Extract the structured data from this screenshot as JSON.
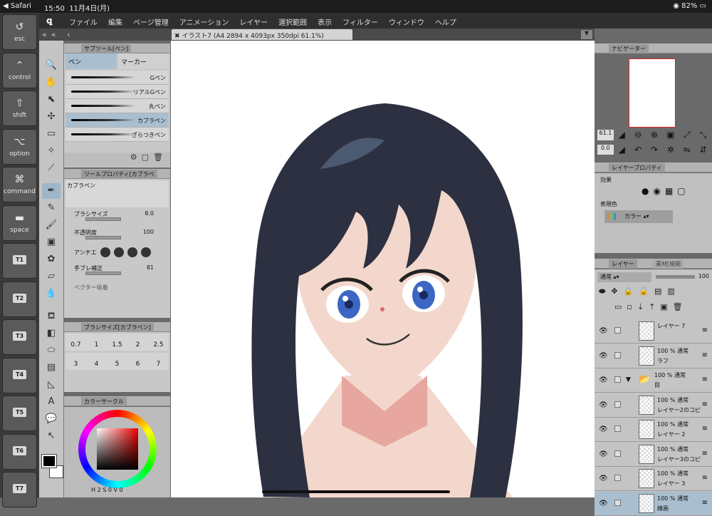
{
  "status": {
    "app": "◀ Safari",
    "time": "15:50",
    "date": "11月4日(月)",
    "battery": "82%"
  },
  "menu": {
    "logo": "ꝗ",
    "items": [
      "ファイル",
      "編集",
      "ページ管理",
      "アニメーション",
      "レイヤー",
      "選択範囲",
      "表示",
      "フィルター",
      "ウィンドウ",
      "ヘルプ"
    ]
  },
  "keys": [
    {
      "icon": "↺",
      "label": "esc"
    },
    {
      "icon": "⌃",
      "label": "control"
    },
    {
      "icon": "⇧",
      "label": "shift"
    },
    {
      "icon": "⌥",
      "label": "option"
    },
    {
      "icon": "⌘",
      "label": "command"
    },
    {
      "icon": "▬",
      "label": "space"
    },
    {
      "tb": "T1"
    },
    {
      "tb": "T2"
    },
    {
      "tb": "T3"
    },
    {
      "tb": "T4"
    },
    {
      "tb": "T5"
    },
    {
      "tb": "T6"
    },
    {
      "tb": "T7"
    }
  ],
  "document": {
    "tab": "イラスト7 (A4 2894 x 4093px 350dpi 61.1%)"
  },
  "subtool": {
    "title": "サブツール[ペン]",
    "tabs": [
      "ペン",
      "マーカー"
    ],
    "items": [
      "Gペン",
      "リアルGペン",
      "丸ペン",
      "カブラペン",
      "ざらつきペン"
    ],
    "selected": 3
  },
  "toolprop": {
    "title": "ツールプロパティ[カブラペ",
    "brush_name": "カブラペン",
    "size_label": "ブラシサイズ",
    "size_value": "8.0",
    "opacity_label": "不透明度",
    "opacity_value": "100",
    "aa_label": "アンチエ",
    "stab_label": "手ブレ補正",
    "stab_value": "81",
    "vector_label": "ベクター吸着"
  },
  "brushsize": {
    "title": "ブラシサイズ[カブラペン]",
    "values": [
      "0.7",
      "1",
      "1.5",
      "2",
      "2.5",
      "3",
      "4",
      "5",
      "6",
      "7"
    ]
  },
  "colorcircle": {
    "title": "カラーサークル",
    "h": "2",
    "s": "0",
    "v": "0"
  },
  "navigator": {
    "title": "ナビゲーター",
    "zoom": "61.1",
    "angle": "0.0"
  },
  "layerprop": {
    "title": "レイヤープロパティ",
    "effect_label": "効果",
    "expr_label": "表現色",
    "expr_value": "カラー"
  },
  "layers": {
    "title": "レイヤー",
    "tab2": "素材[検閲",
    "blend": "通常",
    "opacity": "100",
    "rows": [
      {
        "line1": "レイヤー 7",
        "line2": ""
      },
      {
        "line1": "100 % 通常",
        "line2": "ラフ"
      },
      {
        "line1": "100 % 通常",
        "line2": "目",
        "folder": true
      },
      {
        "line1": "100 % 通常",
        "line2": "レイヤー2のコピー"
      },
      {
        "line1": "100 % 通常",
        "line2": "レイヤー 2"
      },
      {
        "line1": "100 % 通常",
        "line2": "レイヤー3のコピー"
      },
      {
        "line1": "100 % 通常",
        "line2": "レイヤー 3"
      },
      {
        "line1": "100 % 通常",
        "line2": "線画"
      }
    ]
  }
}
